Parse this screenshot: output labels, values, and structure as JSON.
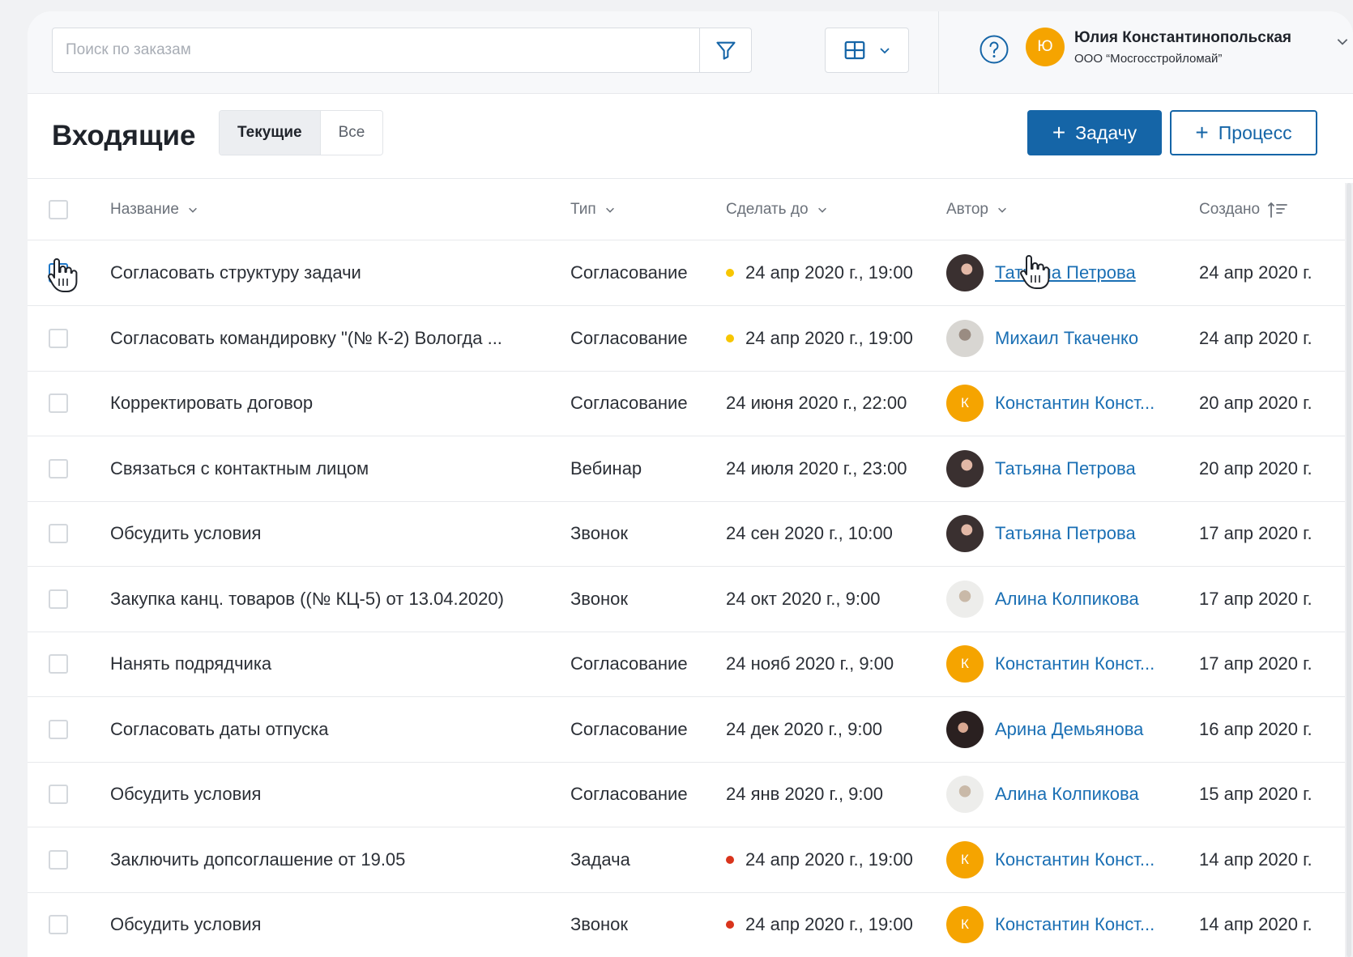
{
  "search": {
    "placeholder": "Поиск по заказам"
  },
  "icons": {
    "filter": "filter-icon",
    "view": "grid-view-icon",
    "help": "help-icon",
    "chevron": "chevron-down-icon",
    "sort": "sort-ascending-icon",
    "cursor": "hand-pointer-icon"
  },
  "user": {
    "initial": "Ю",
    "name": "Юлия Константинопольская",
    "org": "ООО “Мосгосстройломай”"
  },
  "page": {
    "title": "Входящие",
    "tabs": [
      {
        "label": "Текущие",
        "active": true
      },
      {
        "label": "Все",
        "active": false
      }
    ],
    "add_task_label": "Задачу",
    "add_process_label": "Процесс"
  },
  "colors": {
    "primary": "#1565a7",
    "link": "#1a6fb4",
    "avatar_orange": "#f5a400",
    "dot_yellow": "#f7c600",
    "dot_red": "#d9341c"
  },
  "table": {
    "columns": {
      "name": "Название",
      "type": "Тип",
      "due": "Сделать до",
      "author": "Автор",
      "created": "Создано"
    },
    "rows": [
      {
        "name": "Согласовать структуру задачи",
        "type": "Согласование",
        "due": "24 апр 2020 г., 19:00",
        "dot": "yellow",
        "author": "Татьяна Петрова",
        "avatar": "photo-dark",
        "created": "24 апр 2020 г."
      },
      {
        "name": "Согласовать командировку \"(№ К-2) Вологда ...",
        "type": "Согласование",
        "due": "24 апр 2020 г., 19:00",
        "dot": "yellow",
        "author": "Михаил Ткаченко",
        "avatar": "photo-gray",
        "created": "24 апр 2020 г."
      },
      {
        "name": "Корректировать договор",
        "type": "Согласование",
        "due": "24 июня 2020 г., 22:00",
        "dot": "",
        "author": "Константин Конст...",
        "avatar": "К",
        "created": "20 апр 2020 г."
      },
      {
        "name": "Связаться с контактным лицом",
        "type": "Вебинар",
        "due": "24 июля 2020 г., 23:00",
        "dot": "",
        "author": "Татьяна Петрова",
        "avatar": "photo-dark",
        "created": "20 апр 2020 г."
      },
      {
        "name": "Обсудить условия",
        "type": "Звонок",
        "due": "24 сен 2020 г., 10:00",
        "dot": "",
        "author": "Татьяна Петрова",
        "avatar": "photo-dark",
        "created": "17 апр 2020 г."
      },
      {
        "name": "Закупка канц. товаров ((№ КЦ-5) от 13.04.2020)",
        "type": "Звонок",
        "due": "24 окт 2020 г., 9:00",
        "dot": "",
        "author": "Алина Колпикова",
        "avatar": "photo-light",
        "created": "17 апр 2020 г."
      },
      {
        "name": "Нанять подрядчика",
        "type": "Согласование",
        "due": "24 нояб 2020 г., 9:00",
        "dot": "",
        "author": "Константин Конст...",
        "avatar": "К",
        "created": "17 апр 2020 г."
      },
      {
        "name": "Согласовать даты отпуска",
        "type": "Согласование",
        "due": "24 дек 2020 г., 9:00",
        "dot": "",
        "author": "Арина Демьянова",
        "avatar": "photo-dark2",
        "created": "16 апр 2020 г."
      },
      {
        "name": "Обсудить условия",
        "type": "Согласование",
        "due": "24 янв 2020 г., 9:00",
        "dot": "",
        "author": "Алина Колпикова",
        "avatar": "photo-light",
        "created": "15 апр 2020 г."
      },
      {
        "name": "Заключить допсоглашение от 19.05",
        "type": "Задача",
        "due": "24 апр 2020 г., 19:00",
        "dot": "red",
        "author": "Константин Конст...",
        "avatar": "К",
        "created": "14 апр 2020 г."
      },
      {
        "name": "Обсудить условия",
        "type": "Звонок",
        "due": "24 апр 2020 г., 19:00",
        "dot": "red",
        "author": "Константин Конст...",
        "avatar": "К",
        "created": "14 апр 2020 г."
      }
    ]
  }
}
